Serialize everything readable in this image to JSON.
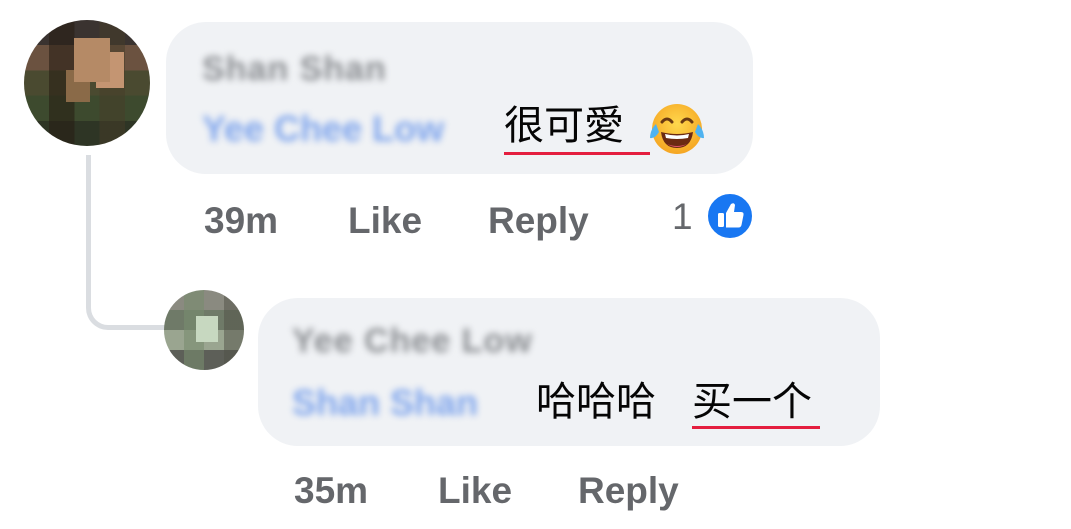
{
  "comments": [
    {
      "author": "Shan Shan",
      "mention": "Yee Chee Low",
      "text": "很可愛",
      "emoji": "tears-of-joy-emoji",
      "time": "39m",
      "like_label": "Like",
      "reply_label": "Reply",
      "reaction_count": "1",
      "reaction_icon": "like-reaction-icon"
    },
    {
      "author": "Yee Chee Low",
      "mention": "Shan Shan",
      "text_laugh": "哈哈哈",
      "text_main": "买一个",
      "time": "35m",
      "like_label": "Like",
      "reply_label": "Reply"
    }
  ],
  "colors": {
    "bubble": "#f0f2f5",
    "meta_text": "#65676b",
    "mention": "#7fa5ec",
    "underline": "#e41e3f",
    "like_blue": "#1877f2"
  }
}
